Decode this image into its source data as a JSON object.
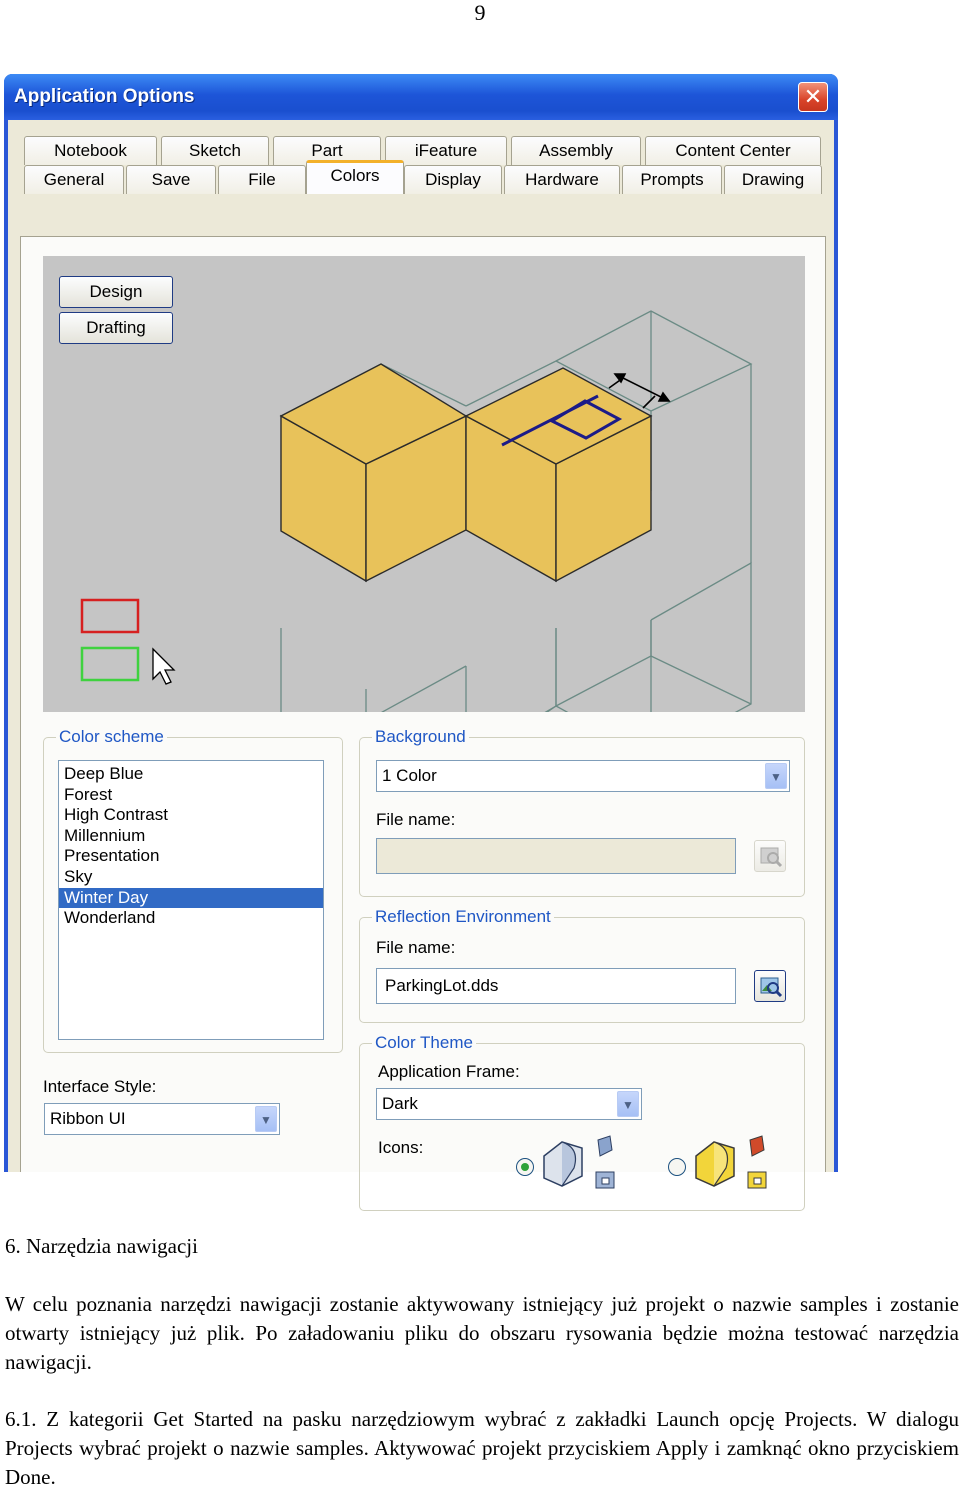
{
  "page_number": "9",
  "dialog": {
    "title": "Application Options",
    "close_glyph": "✕",
    "tabs_row1": [
      "Notebook",
      "Sketch",
      "Part",
      "iFeature",
      "Assembly",
      "Content Center"
    ],
    "tabs_row2": [
      "General",
      "Save",
      "File",
      "Colors",
      "Display",
      "Hardware",
      "Prompts",
      "Drawing"
    ],
    "active_tab": "Colors",
    "preview": {
      "buttons": [
        "Design",
        "Drafting"
      ],
      "box_color": "#e8c25a",
      "highlight_colors": [
        "#d62020",
        "#3fd23f"
      ]
    },
    "color_scheme": {
      "label": "Color scheme",
      "items": [
        "Deep Blue",
        "Forest",
        "High Contrast",
        "Millennium",
        "Presentation",
        "Sky",
        "Winter Day",
        "Wonderland"
      ],
      "selected": "Winter Day"
    },
    "interface_style": {
      "label": "Interface Style:",
      "value": "Ribbon UI"
    },
    "background": {
      "label": "Background",
      "value": "1 Color",
      "file_label": "File name:",
      "file_value": ""
    },
    "reflection": {
      "label": "Reflection Environment",
      "file_label": "File name:",
      "file_value": "ParkingLot.dds"
    },
    "color_theme": {
      "label": "Color Theme",
      "frame_label": "Application Frame:",
      "frame_value": "Dark",
      "icons_label": "Icons:",
      "selected_icon_option": "first"
    },
    "accent_color": "#1f57c5",
    "selection_color": "#316ac5"
  },
  "document": {
    "heading": "6.  Narzędzia nawigacji",
    "paragraph1": "W celu poznania narzędzi nawigacji zostanie aktywowany istniejący już projekt o nazwie samples i zostanie otwarty istniejący już plik. Po załadowaniu pliku do obszaru rysowania będzie można testować narzędzia nawigacji.",
    "paragraph2": "6.1. Z kategorii Get Started na pasku narzędziowym wybrać z zakładki Launch opcję Projects. W dialogu Projects wybrać projekt o nazwie samples. Aktywować projekt przyciskiem Apply i zamknąć okno przyciskiem Done."
  }
}
